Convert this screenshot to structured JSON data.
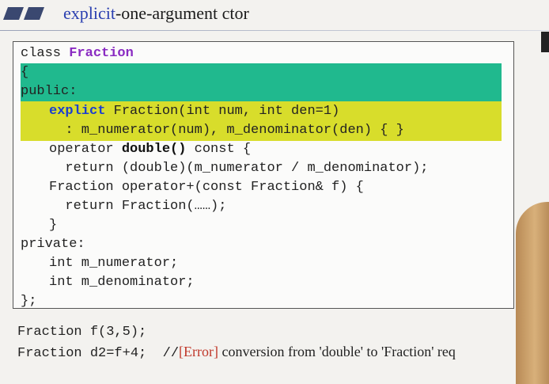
{
  "header": {
    "title_accent": "explicit",
    "title_rest": "-one-argument ctor"
  },
  "code": {
    "l1_kw": "class ",
    "l1_name": "Fraction",
    "l2": "{",
    "l3": "public:",
    "l4_kw": "explict",
    "l4_rest": " Fraction(int num, int den=1)",
    "l5": "  : m_numerator(num), m_denominator(den) { }",
    "l6_a": "operator ",
    "l6_b": "double()",
    "l6_c": " const {",
    "l7": "  return (double)(m_numerator / m_denominator);",
    "l8": "Fraction operator+(const Fraction& f) {",
    "l9": "  return Fraction(……);",
    "l10": "}",
    "l11": "private:",
    "l12": "int m_numerator;",
    "l13": "int m_denominator;",
    "l14": "};"
  },
  "usage": {
    "line1": "Fraction f(3,5);",
    "line2_code": "Fraction d2=f+4;  //",
    "line2_err": "[Error]",
    "line2_msg": " conversion from 'double' to 'Fraction' req"
  },
  "colors": {
    "accent": "#2a3fb0",
    "green_highlight": "#20b98e",
    "yellow_highlight": "#d8dd2b",
    "class_name": "#8a2bc2",
    "keyword": "#1b3fd0",
    "error": "#c0392b"
  }
}
